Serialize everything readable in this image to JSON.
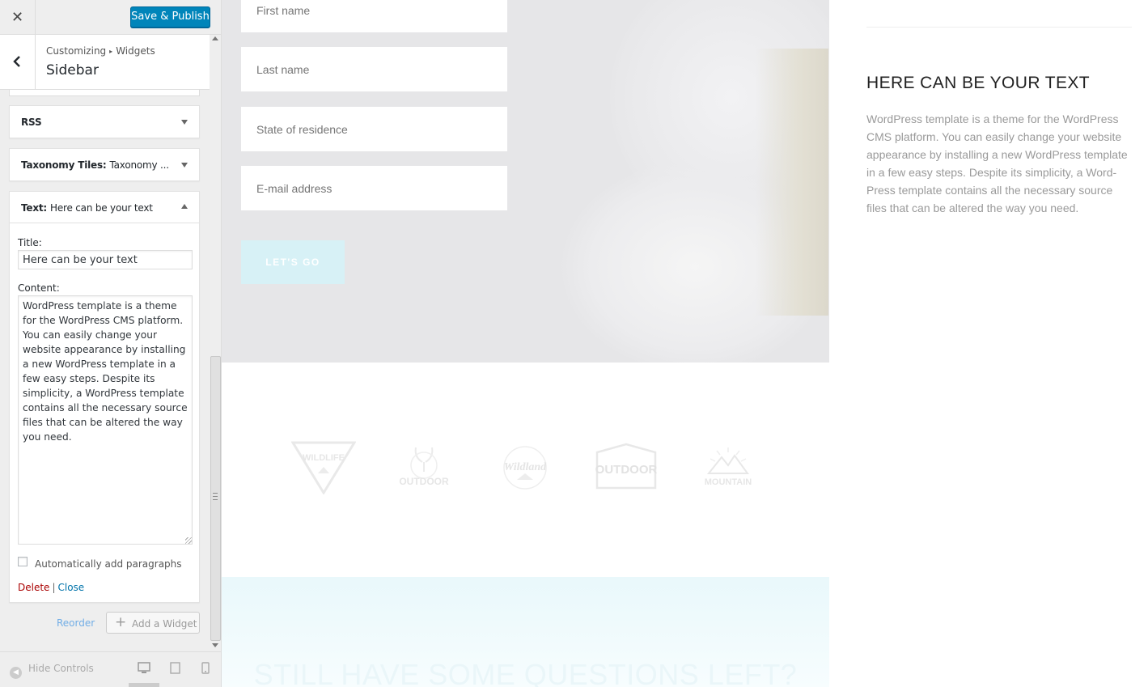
{
  "topbar": {
    "close_glyph": "✕",
    "publish_label": "Save & Publish"
  },
  "section": {
    "breadcrumb_parent": "Customizing",
    "breadcrumb_child": "Widgets",
    "title": "Sidebar"
  },
  "widgets": [
    {
      "name": "RSS",
      "subtitle": ""
    },
    {
      "name": "Taxonomy Tiles:",
      "subtitle": "Taxonomy ..."
    },
    {
      "name": "Text:",
      "subtitle": "Here can be your text"
    }
  ],
  "text_widget": {
    "title_label": "Title:",
    "title_value": "Here can be your text",
    "content_label": "Content:",
    "content_value": "WordPress template is a theme for the WordPress CMS platform. You can easily change your website appearance by installing a new WordPress template in a few easy steps. Despite its simplicity, a WordPress template contains all the necessary source files that can be altered the way you need.",
    "autop_label": "Automatically add paragraphs",
    "autop_checked": false,
    "delete_label": "Delete",
    "separator": "|",
    "close_label": "Close"
  },
  "panel_actions": {
    "reorder_label": "Reorder",
    "add_widget_label": "Add a Widget"
  },
  "footer": {
    "hide_controls_label": "Hide Controls",
    "active_device": "desktop"
  },
  "preview": {
    "form": {
      "first_name_placeholder": "First name",
      "last_name_placeholder": "Last name",
      "state_placeholder": "State of residence",
      "email_placeholder": "E-mail address",
      "submit_label": "LET'S GO"
    },
    "logos": [
      {
        "name": "wildlife-logo",
        "text": "WILDLIFE"
      },
      {
        "name": "outdoor-deer-logo",
        "text": "OUTDOOR"
      },
      {
        "name": "wildland-logo",
        "text": "Wildland"
      },
      {
        "name": "outdoor-badge-logo",
        "text": "OUTDOOR"
      },
      {
        "name": "mountain-logo",
        "text": "MOUNTAIN"
      }
    ],
    "cta_title": "STILL HAVE SOME QUESTIONS LEFT?",
    "sidebar_title": "HERE CAN BE YOUR TEXT",
    "sidebar_text": "WordPress template is a theme for the WordPress CMS platform. You can easily change your website appearance by installing a new WordPress template in a few easy steps. Despite its simplicity, a Word-Press template contains all the necessary source files that can be altered the way you need."
  },
  "colors": {
    "publish": "#0085ba",
    "delete": "#aa0000",
    "link": "#0073aa",
    "button_light": "#d7f1f6"
  }
}
